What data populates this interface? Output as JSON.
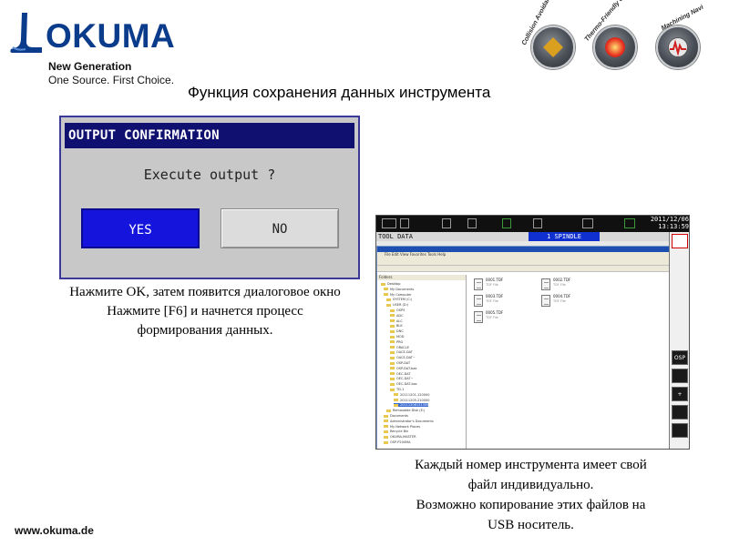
{
  "brand": {
    "name": "OKUMA",
    "tagline_bold": "New Generation",
    "tagline": "One Source. First Choice.",
    "color": "#0b3c8c"
  },
  "page_title": "Функция сохранения данных инструмента",
  "badges": [
    {
      "caption": "Collision Avoidance System",
      "icon": "shield-icon",
      "accent": "#d9a020"
    },
    {
      "caption": "Thermo-Friendly Concept",
      "icon": "thermo-icon",
      "accent": "#d83020"
    },
    {
      "caption": "Machining Navi",
      "icon": "navi-icon",
      "accent": "#202020"
    }
  ],
  "dialog": {
    "title": "OUTPUT CONFIRMATION",
    "message": "Execute output ?",
    "yes_label": "YES",
    "no_label": "NO"
  },
  "caption_left": [
    "Нажмите OK, затем появится диалоговое окно",
    "Нажмите [F6] и начнется процесс",
    "формирования данных."
  ],
  "osp_screen": {
    "mode_label": "TOOL DATA",
    "spindle_label": "1 SPINDLE",
    "date": "2011/12/06",
    "time": "13:13:59",
    "explorer": {
      "menu": "File   Edit   View   Favorites   Tools   Help",
      "tree_header": "Folders",
      "tree_items": [
        "Desktop",
        "My Documents",
        "My Computer",
        "SYSTEM (C:)",
        "USER (D:)",
        "OSP5",
        "ADC",
        "ALC",
        "BLK",
        "DNC",
        "MOD",
        "PRG",
        "ORACLE",
        "OACE-DAT",
        "OACE-DAT~",
        "OSP-DAT",
        "OSP-DAT-bak",
        "OEC-DAT",
        "OEC-DAT~",
        "OEC-DAT-bac",
        "TD-1",
        "20111201-120000",
        "20111205-210000",
        "20111206131305",
        "Removable Disk (E:)",
        "Documents",
        "Administrator's Documents",
        "My Network Places",
        "Recycle Bin",
        "OKUMA-MASTER",
        "OSP-P200MA"
      ],
      "files": [
        {
          "name": "0001.TDF",
          "sub": "TDF File"
        },
        {
          "name": "0002.TDF",
          "sub": "TDF File"
        },
        {
          "name": "0003.TDF",
          "sub": "TDF File"
        },
        {
          "name": "0004.TDF",
          "sub": "TDF File"
        },
        {
          "name": "0005.TDF",
          "sub": "TDF File"
        }
      ]
    }
  },
  "caption_right": [
    "Каждый номер инструмента  имеет свой",
    "файл индивидуально.",
    "Возможно копирование этих файлов на",
    "USB носитель."
  ],
  "footer_url": "www.okuma.de"
}
